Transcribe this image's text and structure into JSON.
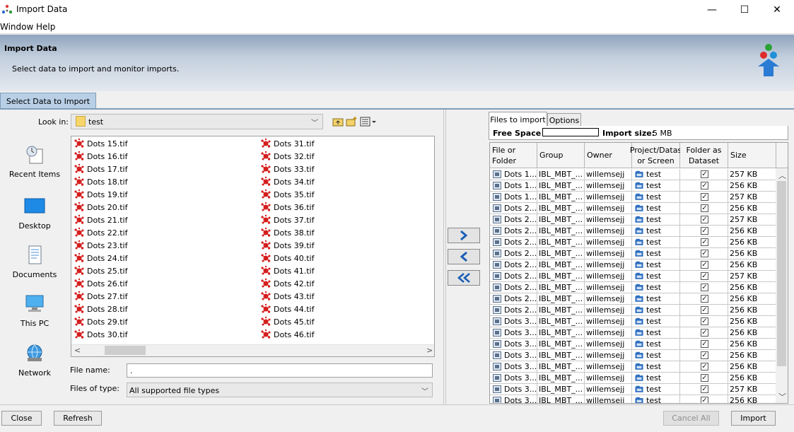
{
  "window": {
    "title": "Import Data",
    "icon": "omero-dots-icon",
    "controls": {
      "minimize": "—",
      "maximize": "☐",
      "close": "✕"
    }
  },
  "menu": [
    "Window",
    "Help"
  ],
  "banner": {
    "title": "Import Data",
    "subtitle": "Select data to import and monitor imports."
  },
  "tabs": {
    "select": "Select Data to Import"
  },
  "chooser": {
    "look_in_label": "Look in:",
    "look_in_value": "test",
    "shortcuts": [
      "Recent Items",
      "Desktop",
      "Documents",
      "This PC",
      "Network"
    ],
    "files_col1": [
      "Dots 15.tif",
      "Dots 16.tif",
      "Dots 17.tif",
      "Dots 18.tif",
      "Dots 19.tif",
      "Dots 20.tif",
      "Dots 21.tif",
      "Dots 22.tif",
      "Dots 23.tif",
      "Dots 24.tif",
      "Dots 25.tif",
      "Dots 26.tif",
      "Dots 27.tif",
      "Dots 28.tif",
      "Dots 29.tif",
      "Dots 30.tif"
    ],
    "files_col2": [
      "Dots 31.tif",
      "Dots 32.tif",
      "Dots 33.tif",
      "Dots 34.tif",
      "Dots 35.tif",
      "Dots 36.tif",
      "Dots 37.tif",
      "Dots 38.tif",
      "Dots 39.tif",
      "Dots 40.tif",
      "Dots 41.tif",
      "Dots 42.tif",
      "Dots 43.tif",
      "Dots 44.tif",
      "Dots 45.tif",
      "Dots 46.tif"
    ],
    "file_name_label": "File name:",
    "file_name_value": ".",
    "file_type_label": "Files of type:",
    "file_type_value": "All supported file types"
  },
  "import_panel": {
    "tabs": [
      "Files to import",
      "Options"
    ],
    "free_space_label": "Free Space",
    "import_size_label": "Import size:",
    "import_size_value": "5 MB",
    "columns": [
      "File or Folder",
      "Group",
      "Owner",
      "Project/Datas or Screen",
      "Folder as Dataset",
      "Size"
    ],
    "rows": [
      {
        "file": "Dots 1...",
        "group": "IBL_MBT_...",
        "owner": "willemsejj",
        "target": "test",
        "size": "257 KB"
      },
      {
        "file": "Dots 1...",
        "group": "IBL_MBT_...",
        "owner": "willemsejj",
        "target": "test",
        "size": "256 KB"
      },
      {
        "file": "Dots 1...",
        "group": "IBL_MBT_...",
        "owner": "willemsejj",
        "target": "test",
        "size": "257 KB"
      },
      {
        "file": "Dots 2...",
        "group": "IBL_MBT_...",
        "owner": "willemsejj",
        "target": "test",
        "size": "256 KB"
      },
      {
        "file": "Dots 2...",
        "group": "IBL_MBT_...",
        "owner": "willemsejj",
        "target": "test",
        "size": "257 KB"
      },
      {
        "file": "Dots 2...",
        "group": "IBL_MBT_...",
        "owner": "willemsejj",
        "target": "test",
        "size": "256 KB"
      },
      {
        "file": "Dots 2...",
        "group": "IBL_MBT_...",
        "owner": "willemsejj",
        "target": "test",
        "size": "256 KB"
      },
      {
        "file": "Dots 2...",
        "group": "IBL_MBT_...",
        "owner": "willemsejj",
        "target": "test",
        "size": "256 KB"
      },
      {
        "file": "Dots 2...",
        "group": "IBL_MBT_...",
        "owner": "willemsejj",
        "target": "test",
        "size": "256 KB"
      },
      {
        "file": "Dots 2...",
        "group": "IBL_MBT_...",
        "owner": "willemsejj",
        "target": "test",
        "size": "257 KB"
      },
      {
        "file": "Dots 2...",
        "group": "IBL_MBT_...",
        "owner": "willemsejj",
        "target": "test",
        "size": "256 KB"
      },
      {
        "file": "Dots 2...",
        "group": "IBL_MBT_...",
        "owner": "willemsejj",
        "target": "test",
        "size": "256 KB"
      },
      {
        "file": "Dots 2...",
        "group": "IBL_MBT_...",
        "owner": "willemsejj",
        "target": "test",
        "size": "256 KB"
      },
      {
        "file": "Dots 3...",
        "group": "IBL_MBT_...",
        "owner": "willemsejj",
        "target": "test",
        "size": "256 KB"
      },
      {
        "file": "Dots 3...",
        "group": "IBL_MBT_...",
        "owner": "willemsejj",
        "target": "test",
        "size": "256 KB"
      },
      {
        "file": "Dots 3...",
        "group": "IBL_MBT_...",
        "owner": "willemsejj",
        "target": "test",
        "size": "256 KB"
      },
      {
        "file": "Dots 3...",
        "group": "IBL_MBT_...",
        "owner": "willemsejj",
        "target": "test",
        "size": "256 KB"
      },
      {
        "file": "Dots 3...",
        "group": "IBL_MBT_...",
        "owner": "willemsejj",
        "target": "test",
        "size": "256 KB"
      },
      {
        "file": "Dots 3...",
        "group": "IBL_MBT_...",
        "owner": "willemsejj",
        "target": "test",
        "size": "256 KB"
      },
      {
        "file": "Dots 3...",
        "group": "IBL_MBT_...",
        "owner": "willemsejj",
        "target": "test",
        "size": "257 KB"
      },
      {
        "file": "Dots 3...",
        "group": "IBL_MBT_...",
        "owner": "willemsejj",
        "target": "test",
        "size": "256 KB"
      }
    ]
  },
  "buttons": {
    "close": "Close",
    "refresh": "Refresh",
    "cancel_all": "Cancel All",
    "import": "Import"
  },
  "colors": {
    "banner_top": "#8fa4bd",
    "tab_active": "#b8cfe5",
    "file_icon": "#d51e1e",
    "dataset_icon": "#2f6fbf"
  }
}
